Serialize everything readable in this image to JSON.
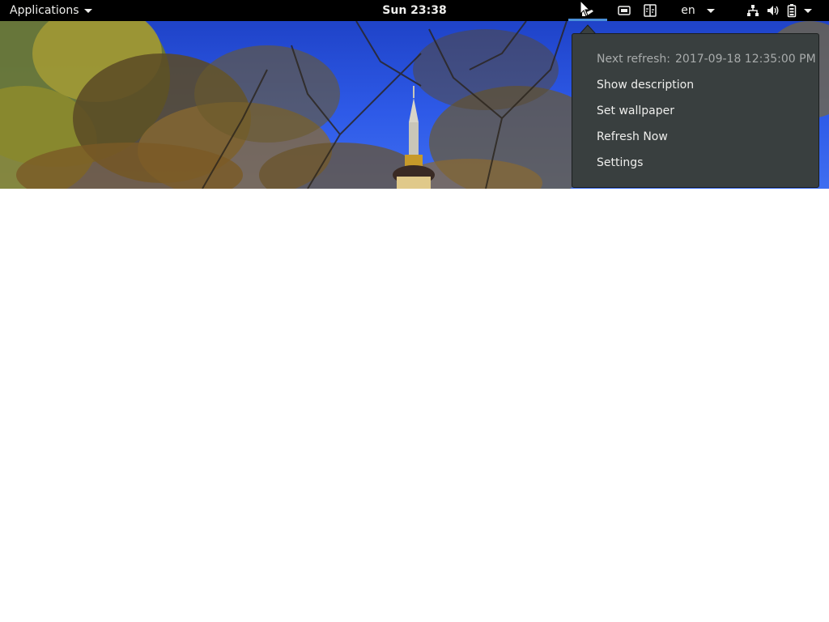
{
  "topbar": {
    "applications_label": "Applications",
    "clock": "Sun 23:38",
    "language": "en",
    "icons": {
      "bing": "bing-wallpaper-icon",
      "screenshot": "screenshot-icon",
      "split": "split-screen-icon",
      "network": "network-wired-icon",
      "volume": "volume-icon",
      "battery": "battery-icon"
    }
  },
  "menu": {
    "next_refresh_label": "Next refresh:",
    "next_refresh_value": "2017-09-18 12:35:00 PM",
    "items": [
      {
        "label": "Show description"
      },
      {
        "label": "Set wallpaper"
      },
      {
        "label": "Refresh Now"
      },
      {
        "label": "Settings"
      }
    ]
  },
  "colors": {
    "topbar_bg": "#000000",
    "menu_bg": "#393f3f",
    "accent": "#4a90d9",
    "text": "#eeeeec",
    "muted_text": "#a8abab"
  }
}
